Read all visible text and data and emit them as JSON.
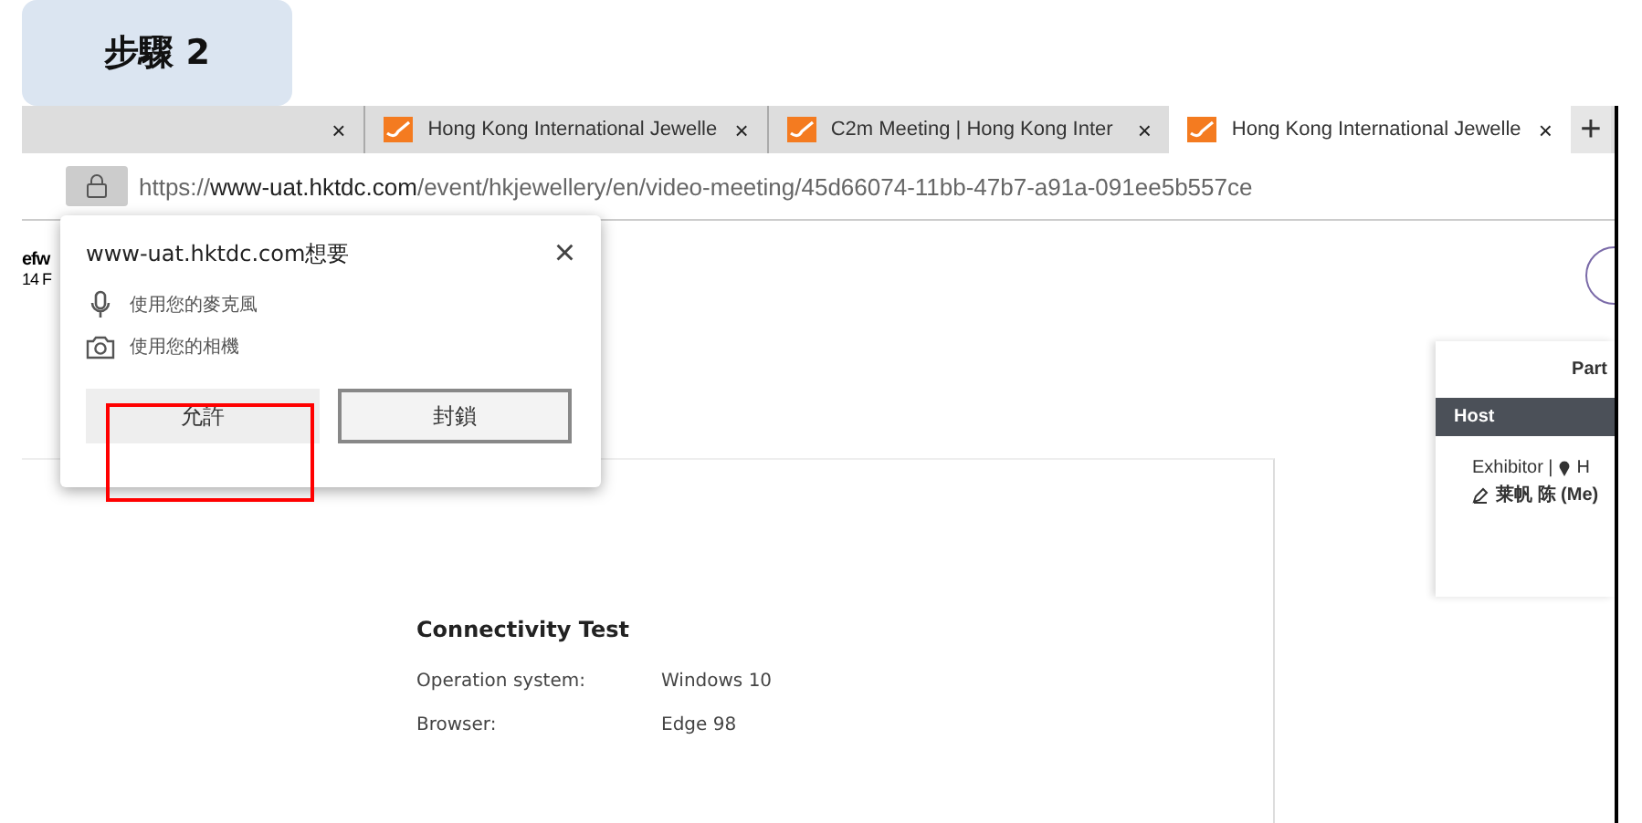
{
  "step_label": "步驟 2",
  "tabs": [
    {
      "kind": "cut",
      "close": "×",
      "selected": false
    },
    {
      "kind": "full",
      "title": "Hong Kong International Jewelle",
      "close": "×",
      "selected": false
    },
    {
      "kind": "full",
      "title": "C2m Meeting | Hong Kong Inter",
      "close": "×",
      "selected": false
    },
    {
      "kind": "full",
      "title": "Hong Kong International Jewelle",
      "close": "×",
      "selected": true
    }
  ],
  "new_tab": "+",
  "address_bar": {
    "scheme": "https://",
    "host": "www-uat.hktdc.com",
    "path": "/event/hkjewellery/en/video-meeting/45d66074-11bb-47b7-a91a-091ee5b557ce"
  },
  "permission_popup": {
    "title": "www-uat.hktdc.com想要",
    "close": "×",
    "permissions": [
      {
        "kind": "microphone",
        "label": "使用您的麥克風"
      },
      {
        "kind": "camera",
        "label": "使用您的相機"
      }
    ],
    "buttons": [
      {
        "label": "允許",
        "highlighted": true
      },
      {
        "label": "封鎖",
        "highlighted": false
      }
    ]
  },
  "page_header": {
    "title": "efw",
    "date": "14 F"
  },
  "participants_panel": {
    "title": "Part",
    "section": "Host",
    "role": "Exhibitor |",
    "location": "H",
    "name": "莱帆 陈 (Me)"
  },
  "connectivity_test": {
    "title": "Connectivity Test",
    "rows": [
      {
        "label": "Operation system:",
        "value": "Windows 10"
      },
      {
        "label": "Browser:",
        "value": "Edge 98"
      }
    ]
  }
}
